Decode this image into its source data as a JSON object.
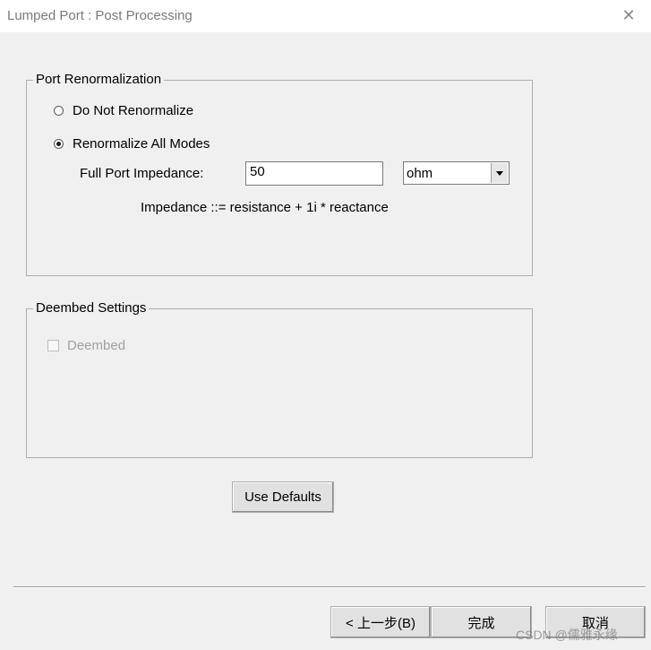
{
  "window": {
    "title": "Lumped Port : Post Processing",
    "close_glyph": "✕"
  },
  "port_renormalization": {
    "group_label": "Port Renormalization",
    "option_do_not": "Do Not Renormalize",
    "option_all_modes": "Renormalize All Modes",
    "selected": "Renormalize All Modes",
    "impedance_label": "Full Port Impedance:",
    "impedance_value": "50",
    "unit_value": "ohm",
    "formula": "Impedance ::= resistance + 1i * reactance"
  },
  "deembed_settings": {
    "group_label": "Deembed Settings",
    "checkbox_label": "Deembed",
    "checked": false,
    "enabled": false
  },
  "buttons": {
    "use_defaults": "Use Defaults",
    "back": "< 上一步(B)",
    "finish": "完成",
    "cancel": "取消"
  },
  "watermark": "CSDN @儒雅永缘"
}
